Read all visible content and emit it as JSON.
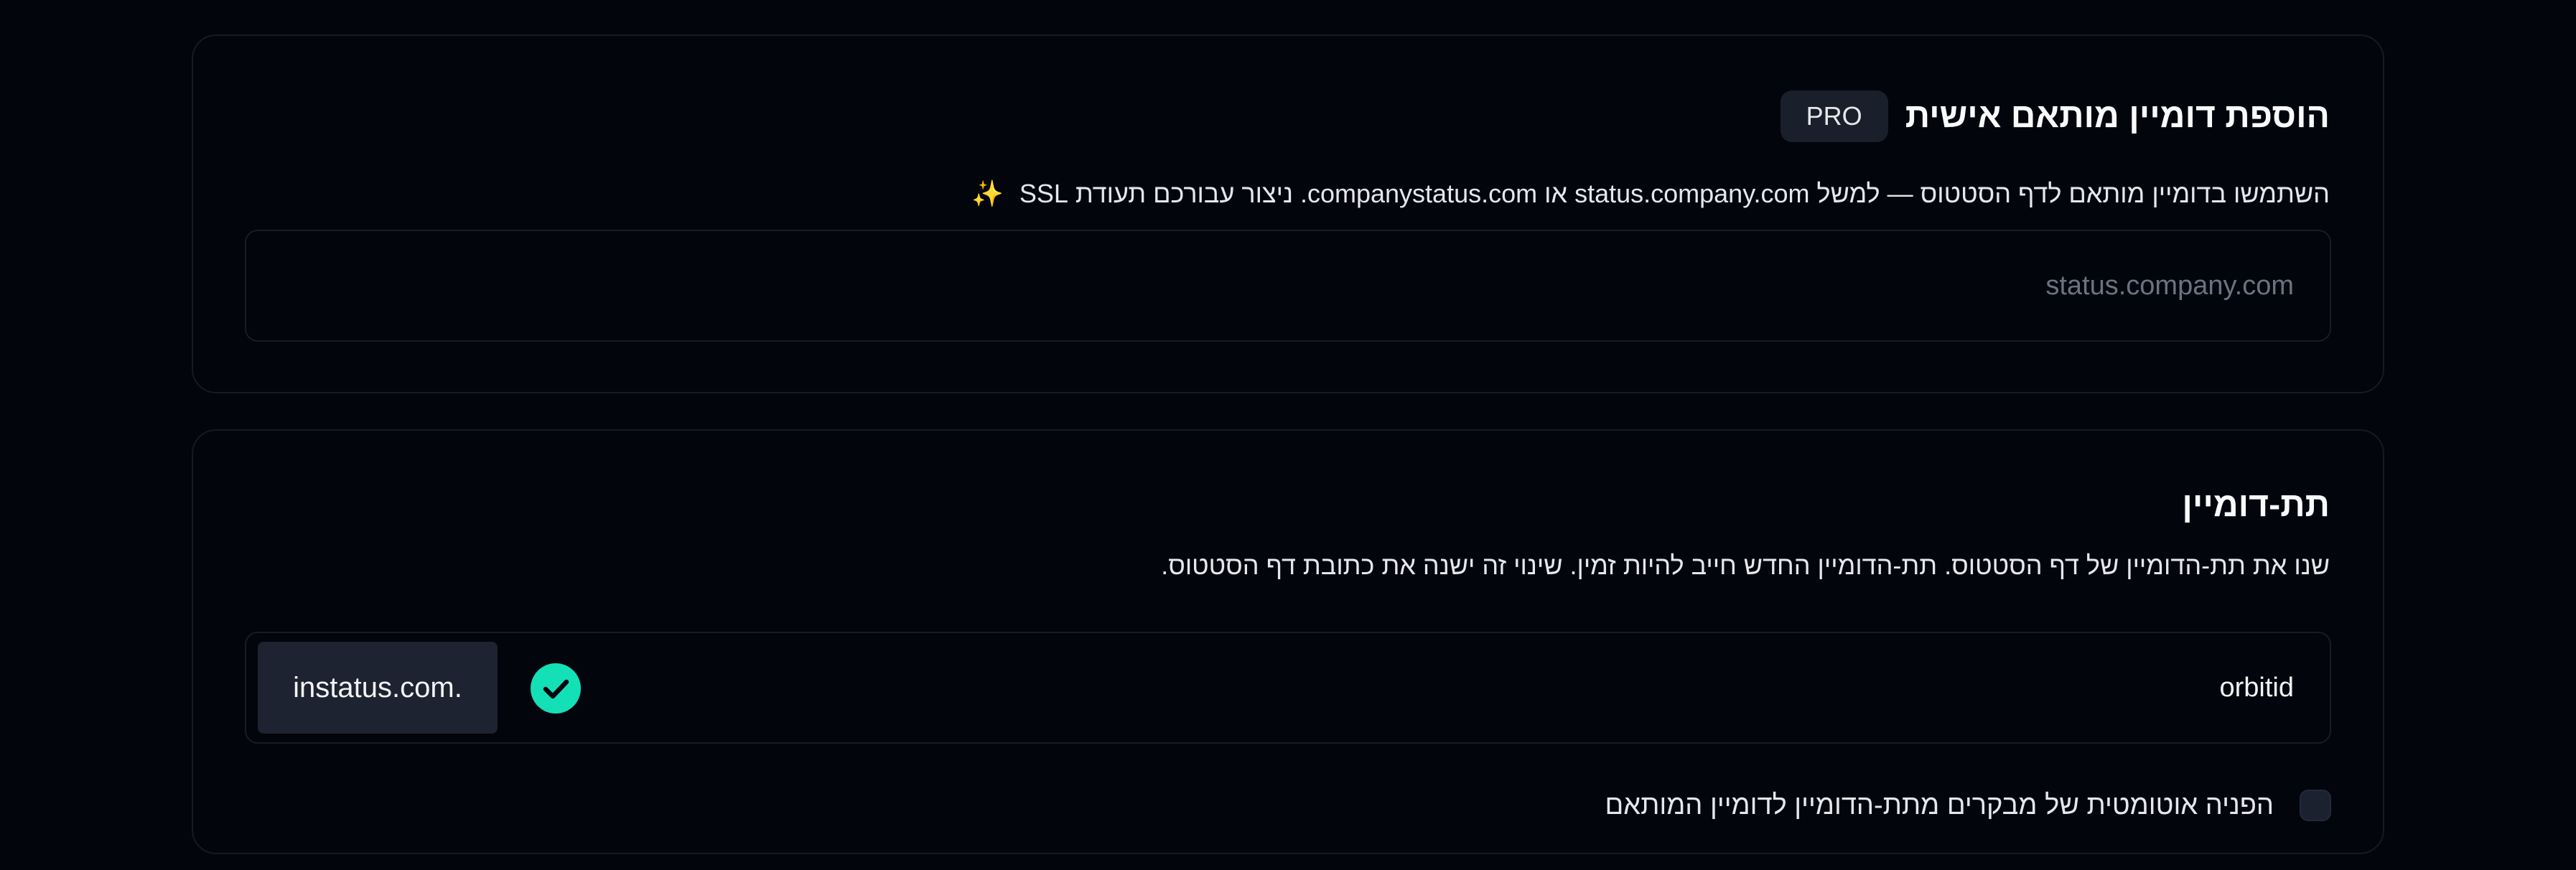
{
  "custom_domain": {
    "title": "הוספת דומיין מותאם אישית",
    "badge": "PRO",
    "description": "השתמשו בדומיין מותאם לדף הסטטוס — למשל status.company.com או companystatus.com. ניצור עבורכם תעודת SSL",
    "sparkle": "✨",
    "input_value": "",
    "input_placeholder": "status.company.com"
  },
  "subdomain": {
    "title": "תת-דומיין",
    "description": "שנו את תת-הדומיין של דף הסטטוס. תת-הדומיין החדש חייב להיות זמין. שינוי זה ישנה את כתובת דף הסטטוס.",
    "input_value": "orbitid",
    "suffix": "instatus.com.",
    "availability_icon": "check-circle-icon",
    "accent_color": "#14e0b8",
    "redirect_label": "הפניה אוטומטית של מבקרים מתת-הדומיין לדומיין המותאם",
    "redirect_checked": false
  }
}
